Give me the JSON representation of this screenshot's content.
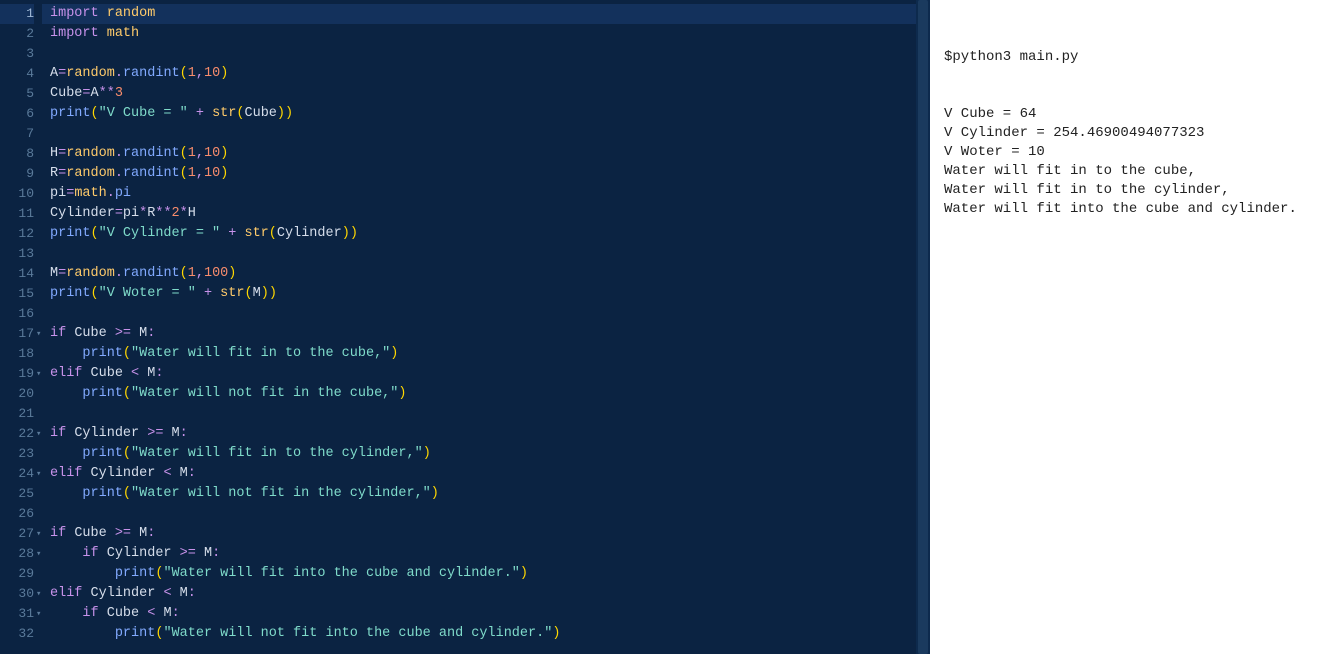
{
  "editor": {
    "lines": [
      {
        "n": 1,
        "fold": false,
        "tokens": [
          [
            "kw",
            "import"
          ],
          [
            "",
            ""
          ],
          [
            "",
            ""
          ],
          [
            "",
            ""
          ],
          [
            "",
            ""
          ],
          [
            "",
            ""
          ],
          [
            "",
            ""
          ],
          [
            "",
            ""
          ],
          [
            "",
            ""
          ]
        ],
        "raw": ""
      },
      {
        "n": 2
      },
      {
        "n": 3
      },
      {
        "n": 4
      },
      {
        "n": 5
      },
      {
        "n": 6
      },
      {
        "n": 7
      },
      {
        "n": 8
      },
      {
        "n": 9
      },
      {
        "n": 10
      },
      {
        "n": 11
      },
      {
        "n": 12
      },
      {
        "n": 13
      },
      {
        "n": 14
      },
      {
        "n": 15
      },
      {
        "n": 16
      },
      {
        "n": 17,
        "fold": true
      },
      {
        "n": 18
      },
      {
        "n": 19,
        "fold": true
      },
      {
        "n": 20
      },
      {
        "n": 21
      },
      {
        "n": 22,
        "fold": true
      },
      {
        "n": 23
      },
      {
        "n": 24,
        "fold": true
      },
      {
        "n": 25
      },
      {
        "n": 26
      },
      {
        "n": 27,
        "fold": true
      },
      {
        "n": 28,
        "fold": true
      },
      {
        "n": 29
      },
      {
        "n": 30,
        "fold": true
      },
      {
        "n": 31,
        "fold": true
      },
      {
        "n": 32
      }
    ],
    "code": {
      "1": [
        [
          "kw",
          "import"
        ],
        [
          "sp",
          " "
        ],
        [
          "cls",
          "random"
        ]
      ],
      "2": [
        [
          "kw",
          "import"
        ],
        [
          "sp",
          " "
        ],
        [
          "cls",
          "math"
        ]
      ],
      "3": [],
      "4": [
        [
          "var",
          "A"
        ],
        [
          "op",
          "="
        ],
        [
          "cls",
          "random"
        ],
        [
          "op",
          "."
        ],
        [
          "func",
          "randint"
        ],
        [
          "paren",
          "("
        ],
        [
          "num",
          "1"
        ],
        [
          "op",
          ","
        ],
        [
          "num",
          "10"
        ],
        [
          "paren",
          ")"
        ]
      ],
      "5": [
        [
          "var",
          "Cube"
        ],
        [
          "op",
          "="
        ],
        [
          "var",
          "A"
        ],
        [
          "op",
          "**"
        ],
        [
          "num",
          "3"
        ]
      ],
      "6": [
        [
          "func",
          "print"
        ],
        [
          "paren",
          "("
        ],
        [
          "str",
          "\"V Cube = \""
        ],
        [
          "sp",
          " "
        ],
        [
          "op",
          "+"
        ],
        [
          "sp",
          " "
        ],
        [
          "cls",
          "str"
        ],
        [
          "paren",
          "("
        ],
        [
          "var",
          "Cube"
        ],
        [
          "paren",
          ")"
        ],
        [
          "paren",
          ")"
        ]
      ],
      "7": [],
      "8": [
        [
          "var",
          "H"
        ],
        [
          "op",
          "="
        ],
        [
          "cls",
          "random"
        ],
        [
          "op",
          "."
        ],
        [
          "func",
          "randint"
        ],
        [
          "paren",
          "("
        ],
        [
          "num",
          "1"
        ],
        [
          "op",
          ","
        ],
        [
          "num",
          "10"
        ],
        [
          "paren",
          ")"
        ]
      ],
      "9": [
        [
          "var",
          "R"
        ],
        [
          "op",
          "="
        ],
        [
          "cls",
          "random"
        ],
        [
          "op",
          "."
        ],
        [
          "func",
          "randint"
        ],
        [
          "paren",
          "("
        ],
        [
          "num",
          "1"
        ],
        [
          "op",
          ","
        ],
        [
          "num",
          "10"
        ],
        [
          "paren",
          ")"
        ]
      ],
      "10": [
        [
          "var",
          "pi"
        ],
        [
          "op",
          "="
        ],
        [
          "cls",
          "math"
        ],
        [
          "op",
          "."
        ],
        [
          "func",
          "pi"
        ]
      ],
      "11": [
        [
          "var",
          "Cylinder"
        ],
        [
          "op",
          "="
        ],
        [
          "var",
          "pi"
        ],
        [
          "op",
          "*"
        ],
        [
          "var",
          "R"
        ],
        [
          "op",
          "**"
        ],
        [
          "num",
          "2"
        ],
        [
          "op",
          "*"
        ],
        [
          "var",
          "H"
        ]
      ],
      "12": [
        [
          "func",
          "print"
        ],
        [
          "paren",
          "("
        ],
        [
          "str",
          "\"V Cylinder = \""
        ],
        [
          "sp",
          " "
        ],
        [
          "op",
          "+"
        ],
        [
          "sp",
          " "
        ],
        [
          "cls",
          "str"
        ],
        [
          "paren",
          "("
        ],
        [
          "var",
          "Cylinder"
        ],
        [
          "paren",
          ")"
        ],
        [
          "paren",
          ")"
        ]
      ],
      "13": [],
      "14": [
        [
          "var",
          "M"
        ],
        [
          "op",
          "="
        ],
        [
          "cls",
          "random"
        ],
        [
          "op",
          "."
        ],
        [
          "func",
          "randint"
        ],
        [
          "paren",
          "("
        ],
        [
          "num",
          "1"
        ],
        [
          "op",
          ","
        ],
        [
          "num",
          "100"
        ],
        [
          "paren",
          ")"
        ]
      ],
      "15": [
        [
          "func",
          "print"
        ],
        [
          "paren",
          "("
        ],
        [
          "str",
          "\"V Woter = \""
        ],
        [
          "sp",
          " "
        ],
        [
          "op",
          "+"
        ],
        [
          "sp",
          " "
        ],
        [
          "cls",
          "str"
        ],
        [
          "paren",
          "("
        ],
        [
          "var",
          "M"
        ],
        [
          "paren",
          ")"
        ],
        [
          "paren",
          ")"
        ]
      ],
      "16": [],
      "17": [
        [
          "kw",
          "if"
        ],
        [
          "sp",
          " "
        ],
        [
          "var",
          "Cube"
        ],
        [
          "sp",
          " "
        ],
        [
          "op",
          ">="
        ],
        [
          "sp",
          " "
        ],
        [
          "var",
          "M"
        ],
        [
          "op",
          ":"
        ]
      ],
      "18": [
        [
          "sp",
          "    "
        ],
        [
          "func",
          "print"
        ],
        [
          "paren",
          "("
        ],
        [
          "str",
          "\"Water will fit in to the cube,\""
        ],
        [
          "paren",
          ")"
        ]
      ],
      "19": [
        [
          "kw",
          "elif"
        ],
        [
          "sp",
          " "
        ],
        [
          "var",
          "Cube"
        ],
        [
          "sp",
          " "
        ],
        [
          "op",
          "<"
        ],
        [
          "sp",
          " "
        ],
        [
          "var",
          "M"
        ],
        [
          "op",
          ":"
        ]
      ],
      "20": [
        [
          "sp",
          "    "
        ],
        [
          "func",
          "print"
        ],
        [
          "paren",
          "("
        ],
        [
          "str",
          "\"Water will not fit in the cube,\""
        ],
        [
          "paren",
          ")"
        ]
      ],
      "21": [],
      "22": [
        [
          "kw",
          "if"
        ],
        [
          "sp",
          " "
        ],
        [
          "var",
          "Cylinder"
        ],
        [
          "sp",
          " "
        ],
        [
          "op",
          ">="
        ],
        [
          "sp",
          " "
        ],
        [
          "var",
          "M"
        ],
        [
          "op",
          ":"
        ]
      ],
      "23": [
        [
          "sp",
          "    "
        ],
        [
          "func",
          "print"
        ],
        [
          "paren",
          "("
        ],
        [
          "str",
          "\"Water will fit in to the cylinder,\""
        ],
        [
          "paren",
          ")"
        ]
      ],
      "24": [
        [
          "kw",
          "elif"
        ],
        [
          "sp",
          " "
        ],
        [
          "var",
          "Cylinder"
        ],
        [
          "sp",
          " "
        ],
        [
          "op",
          "<"
        ],
        [
          "sp",
          " "
        ],
        [
          "var",
          "M"
        ],
        [
          "op",
          ":"
        ]
      ],
      "25": [
        [
          "sp",
          "    "
        ],
        [
          "func",
          "print"
        ],
        [
          "paren",
          "("
        ],
        [
          "str",
          "\"Water will not fit in the cylinder,\""
        ],
        [
          "paren",
          ")"
        ]
      ],
      "26": [],
      "27": [
        [
          "kw",
          "if"
        ],
        [
          "sp",
          " "
        ],
        [
          "var",
          "Cube"
        ],
        [
          "sp",
          " "
        ],
        [
          "op",
          ">="
        ],
        [
          "sp",
          " "
        ],
        [
          "var",
          "M"
        ],
        [
          "op",
          ":"
        ]
      ],
      "28": [
        [
          "sp",
          "    "
        ],
        [
          "kw",
          "if"
        ],
        [
          "sp",
          " "
        ],
        [
          "var",
          "Cylinder"
        ],
        [
          "sp",
          " "
        ],
        [
          "op",
          ">="
        ],
        [
          "sp",
          " "
        ],
        [
          "var",
          "M"
        ],
        [
          "op",
          ":"
        ]
      ],
      "29": [
        [
          "sp",
          "        "
        ],
        [
          "func",
          "print"
        ],
        [
          "paren",
          "("
        ],
        [
          "str",
          "\"Water will fit into the cube and cylinder.\""
        ],
        [
          "paren",
          ")"
        ]
      ],
      "30": [
        [
          "kw",
          "elif"
        ],
        [
          "sp",
          " "
        ],
        [
          "var",
          "Cylinder"
        ],
        [
          "sp",
          " "
        ],
        [
          "op",
          "<"
        ],
        [
          "sp",
          " "
        ],
        [
          "var",
          "M"
        ],
        [
          "op",
          ":"
        ]
      ],
      "31": [
        [
          "sp",
          "    "
        ],
        [
          "kw",
          "if"
        ],
        [
          "sp",
          " "
        ],
        [
          "var",
          "Cube"
        ],
        [
          "sp",
          " "
        ],
        [
          "op",
          "<"
        ],
        [
          "sp",
          " "
        ],
        [
          "var",
          "M"
        ],
        [
          "op",
          ":"
        ]
      ],
      "32": [
        [
          "sp",
          "        "
        ],
        [
          "func",
          "print"
        ],
        [
          "paren",
          "("
        ],
        [
          "str",
          "\"Water will not fit into the cube and cylinder.\""
        ],
        [
          "paren",
          ")"
        ]
      ]
    },
    "active_line": 1
  },
  "output": {
    "command": "$python3 main.py",
    "lines": [
      "V Cube = 64",
      "V Cylinder = 254.46900494077323",
      "V Woter = 10",
      "Water will fit in to the cube,",
      "Water will fit in to the cylinder,",
      "Water will fit into the cube and cylinder."
    ]
  }
}
